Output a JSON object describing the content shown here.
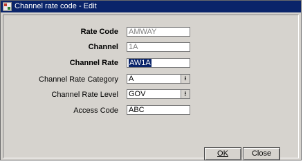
{
  "window": {
    "title": "Channel rate code - Edit"
  },
  "form": {
    "rate_code": {
      "label": "Rate Code",
      "value": "AMWAY"
    },
    "channel": {
      "label": "Channel",
      "value": "1A"
    },
    "channel_rate": {
      "label": "Channel Rate",
      "value": "AW1A"
    },
    "channel_rate_category": {
      "label": "Channel Rate Category",
      "value": "A",
      "dropdown_icon": "dropdown-arrow-icon"
    },
    "channel_rate_level": {
      "label": "Channel Rate Level",
      "value": "GOV",
      "dropdown_icon": "dropdown-arrow-icon"
    },
    "access_code": {
      "label": "Access Code",
      "value": "ABC"
    }
  },
  "buttons": {
    "ok": "OK",
    "close": "Close"
  },
  "colors": {
    "titlebar": "#0a246a",
    "window_bg": "#d6d3ce",
    "selection": "#0a246a"
  }
}
